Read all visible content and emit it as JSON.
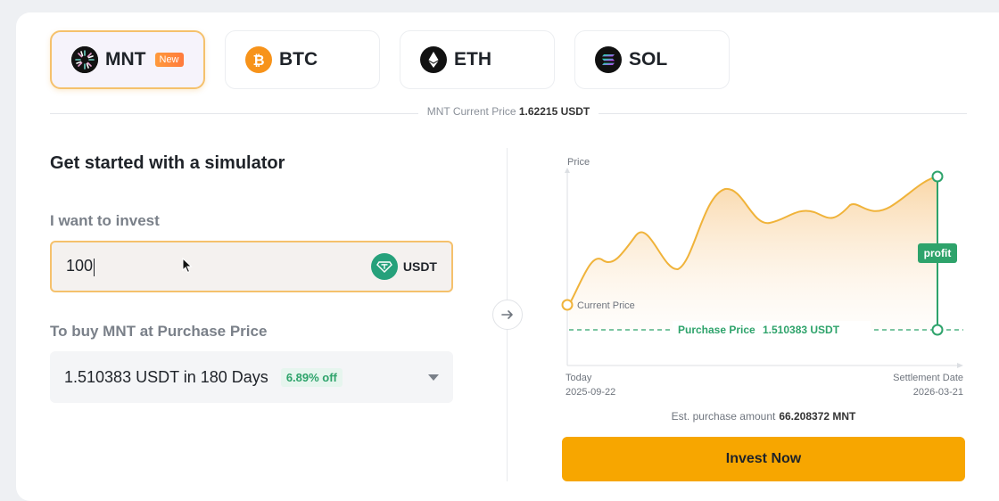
{
  "tabs": [
    {
      "symbol": "MNT",
      "badge": "New",
      "active": true,
      "icon": "mnt-coin-icon"
    },
    {
      "symbol": "BTC",
      "active": false,
      "icon": "btc-coin-icon"
    },
    {
      "symbol": "ETH",
      "active": false,
      "icon": "eth-coin-icon"
    },
    {
      "symbol": "SOL",
      "active": false,
      "icon": "sol-coin-icon"
    }
  ],
  "price_info": {
    "label": "MNT Current Price",
    "value": "1.62215 USDT"
  },
  "simulator": {
    "title": "Get started with a simulator",
    "invest_label": "I want to invest",
    "invest_value": "100",
    "invest_currency": "USDT",
    "buy_label": "To buy MNT at Purchase Price",
    "select_value": "1.510383 USDT in 180 Days",
    "discount_badge": "6.89% off"
  },
  "chart": {
    "y_axis_label": "Price",
    "current_price_label": "Current Price",
    "purchase_price_text": "Purchase Price",
    "purchase_price_value": "1.510383 USDT",
    "profit_label": "profit",
    "start_label": "Today",
    "start_date": "2025-09-22",
    "end_label": "Settlement Date",
    "end_date": "2026-03-21"
  },
  "estimate": {
    "label": "Est. purchase amount",
    "value": "66.208372 MNT"
  },
  "invest_button": "Invest Now",
  "colors": {
    "accent": "#f7a600",
    "curve": "#f0b33a",
    "green": "#2ea36b",
    "active_border": "#f5c16c"
  }
}
